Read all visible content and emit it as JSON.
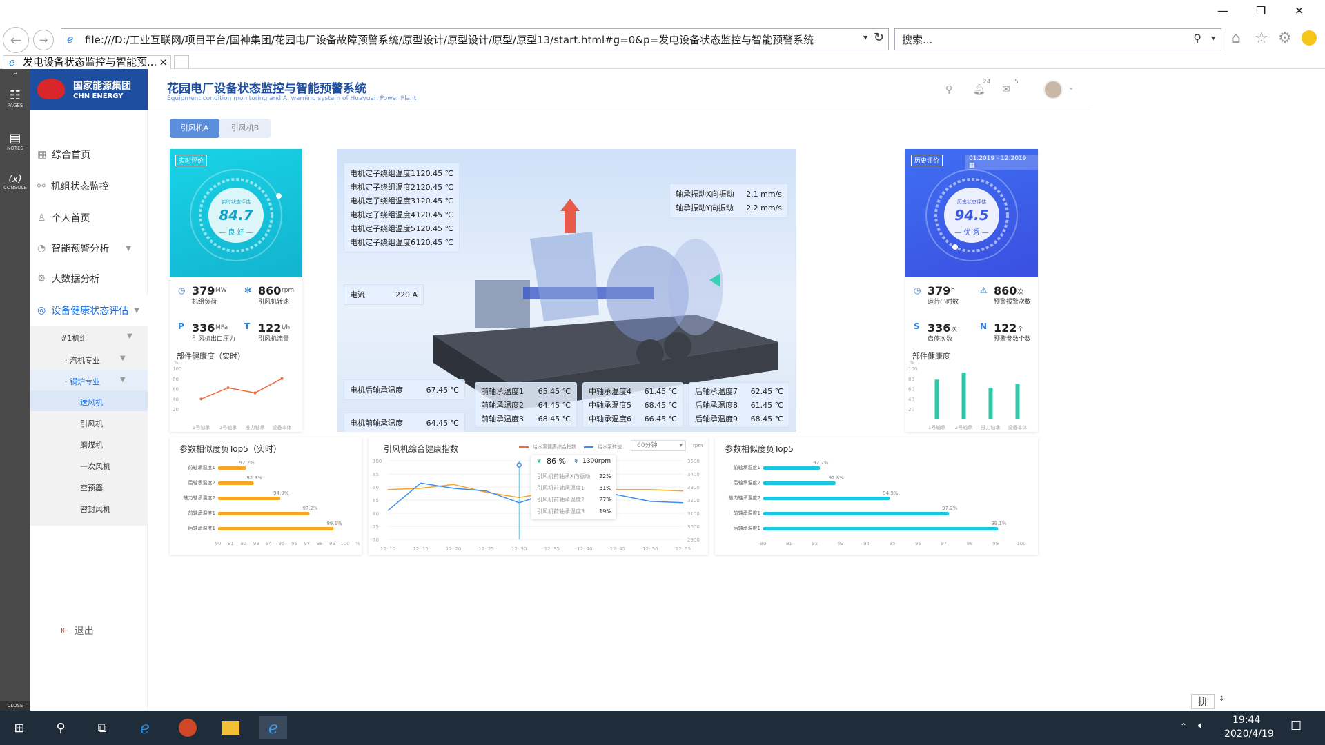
{
  "browser": {
    "address": "file:///D:/工业互联网/项目平台/国神集团/花园电厂设备故障预警系统/原型设计/原型设计/原型/原型13/start.html#g=0&p=发电设备状态监控与智能预警系统",
    "search_placeholder": "搜索...",
    "tab_title": "发电设备状态监控与智能预...",
    "tab_close": "×"
  },
  "axure": {
    "pages": "PAGES",
    "notes": "NOTES",
    "console": "CONSOLE",
    "console_symbol": "(x)",
    "close": "CLOSE"
  },
  "logo": {
    "cn": "国家能源集团",
    "en": "CHN ENERGY"
  },
  "header": {
    "title": "花园电厂设备状态监控与智能预警系统",
    "subtitle": "Equipment condition monitoring and AI warning system of Huayuan Power Plant",
    "bell_count": "24",
    "mail_count": "5"
  },
  "sidebar": {
    "items": [
      {
        "label": "综合首页"
      },
      {
        "label": "机组状态监控"
      },
      {
        "label": "个人首页"
      },
      {
        "label": "智能预警分析"
      },
      {
        "label": "大数据分析"
      },
      {
        "label": "设备健康状态评估"
      }
    ],
    "unit": "#1机组",
    "steam": "· 汽机专业",
    "boiler": "· 锅炉专业",
    "subs": [
      "送风机",
      "引风机",
      "磨煤机",
      "一次风机",
      "空预器",
      "密封风机"
    ],
    "logout": "退出"
  },
  "tabs": [
    "引风机A",
    "引风机B"
  ],
  "realtime": {
    "badge": "实时评价",
    "gauge_label": "实时状态评估",
    "score": "84.7",
    "grade": "— 良 好 —",
    "metrics": [
      {
        "value": "379",
        "unit": "MW",
        "label": "机组负荷"
      },
      {
        "value": "860",
        "unit": "rpm",
        "label": "引风机转速"
      },
      {
        "value": "336",
        "unit": "MPa",
        "label": "引风机出口压力"
      },
      {
        "value": "122",
        "unit": "t/h",
        "label": "引风机流量"
      }
    ],
    "health_title": "部件健康度（实时）",
    "health_ticks": [
      "100",
      "80",
      "60",
      "40",
      "20"
    ],
    "health_cats": [
      "1号轴承",
      "2号轴承",
      "推力轴承",
      "设备本体"
    ]
  },
  "history": {
    "badge": "历史评价",
    "date_range": "01.2019 - 12.2019",
    "gauge_label": "历史状态评估",
    "score": "94.5",
    "grade": "— 优 秀 —",
    "metrics": [
      {
        "value": "379",
        "unit": "h",
        "label": "运行小时数"
      },
      {
        "value": "860",
        "unit": "次",
        "label": "预警报警次数"
      },
      {
        "value": "336",
        "unit": "次",
        "label": "启停次数"
      },
      {
        "value": "122",
        "unit": "个",
        "label": "预警参数个数"
      }
    ],
    "health_title": "部件健康度",
    "health_ticks": [
      "100",
      "80",
      "60",
      "40",
      "20"
    ],
    "health_cats": [
      "1号轴承",
      "2号轴承",
      "推力轴承",
      "设备本体"
    ]
  },
  "readings": {
    "stator": [
      {
        "label": "电机定子绕组温度1",
        "value": "120.45 ℃"
      },
      {
        "label": "电机定子绕组温度2",
        "value": "120.45 ℃"
      },
      {
        "label": "电机定子绕组温度3",
        "value": "120.45 ℃"
      },
      {
        "label": "电机定子绕组温度4",
        "value": "120.45 ℃"
      },
      {
        "label": "电机定子绕组温度5",
        "value": "120.45 ℃"
      },
      {
        "label": "电机定子绕组温度6",
        "value": "120.45 ℃"
      }
    ],
    "current": {
      "label": "电流",
      "value": "220 A"
    },
    "vibration": [
      {
        "label": "轴承振动X向振动",
        "value": "2.1 mm/s"
      },
      {
        "label": "轴承振动Y向振动",
        "value": "2.2 mm/s"
      }
    ],
    "motor_rear": {
      "label": "电机后轴承温度",
      "value": "67.45 ℃"
    },
    "motor_front": {
      "label": "电机前轴承温度",
      "value": "64.45 ℃"
    },
    "front_bearing": [
      {
        "label": "前轴承温度1",
        "value": "65.45 ℃"
      },
      {
        "label": "前轴承温度2",
        "value": "64.45 ℃"
      },
      {
        "label": "前轴承温度3",
        "value": "68.45 ℃"
      }
    ],
    "mid_bearing": [
      {
        "label": "中轴承温度4",
        "value": "61.45 ℃"
      },
      {
        "label": "中轴承温度5",
        "value": "68.45 ℃"
      },
      {
        "label": "中轴承温度6",
        "value": "66.45 ℃"
      }
    ],
    "rear_bearing": [
      {
        "label": "后轴承温度7",
        "value": "62.45 ℃"
      },
      {
        "label": "后轴承温度8",
        "value": "61.45 ℃"
      },
      {
        "label": "后轴承温度9",
        "value": "68.45 ℃"
      }
    ]
  },
  "bottom": {
    "top5_rt_title": "参数相似度负Top5（实时）",
    "top5_title": "参数相似度负Top5",
    "health_title": "引风机综合健康指数",
    "legend1": "给水泵健康综合指数",
    "legend2": "给水泵转速",
    "interval": "60分钟",
    "unit_right": "rpm",
    "tooltip": {
      "pct": "86 %",
      "rpm": "1300rpm",
      "rows": [
        {
          "label": "引风机前轴承X向振动",
          "value": "22%"
        },
        {
          "label": "引风机前轴承温度1",
          "value": "31%"
        },
        {
          "label": "引风机前轴承温度2",
          "value": "27%"
        },
        {
          "label": "引风机前轴承温度3",
          "value": "19%"
        }
      ]
    }
  },
  "system": {
    "time": "19:44",
    "date": "2020/4/19",
    "ime": "拼"
  },
  "colors": {
    "brand": "#1e4ea0",
    "cyan": "#1ac7e0",
    "blue": "#3d5ef0",
    "orange": "#f5a623",
    "red": "#f06a3a"
  },
  "chart_data": [
    {
      "type": "line",
      "title": "部件健康度（实时）",
      "categories": [
        "1号轴承",
        "2号轴承",
        "推力轴承",
        "设备本体"
      ],
      "values": [
        40,
        62,
        52,
        80
      ],
      "ylim": [
        0,
        100
      ]
    },
    {
      "type": "bar",
      "title": "部件健康度",
      "categories": [
        "1号轴承",
        "2号轴承",
        "推力轴承",
        "设备本体"
      ],
      "values": [
        78,
        92,
        62,
        70
      ],
      "ylim": [
        0,
        100
      ]
    },
    {
      "type": "bar",
      "title": "参数相似度负Top5（实时）",
      "orientation": "horizontal",
      "categories": [
        "前轴承温度1",
        "后轴承温度2",
        "推力轴承温度2",
        "前轴承温度1",
        "后轴承温度1"
      ],
      "values": [
        92.2,
        92.8,
        94.9,
        97.2,
        99.1
      ],
      "labels": [
        "92.2%",
        "92.8%",
        "94.9%",
        "97.2%",
        "99.1%"
      ],
      "xticks": [
        "90",
        "91",
        "92",
        "93",
        "94",
        "95",
        "96",
        "97",
        "98",
        "99",
        "100",
        "%"
      ],
      "xlim": [
        90,
        100
      ]
    },
    {
      "type": "line",
      "title": "引风机综合健康指数",
      "x": [
        "12: 10",
        "12: 15",
        "12: 20",
        "12: 25",
        "12: 30",
        "12: 35",
        "12: 40",
        "12: 45",
        "12: 50",
        "12: 55"
      ],
      "yticks_left": [
        "100",
        "95",
        "90",
        "85",
        "80",
        "75",
        "70"
      ],
      "yticks_right": [
        "3500",
        "3400",
        "3300",
        "3200",
        "3100",
        "3000",
        "2900"
      ],
      "series": [
        {
          "name": "给水泵健康综合指数",
          "values": [
            89,
            89.5,
            91,
            88,
            86,
            88,
            88,
            89,
            89,
            88.5
          ]
        },
        {
          "name": "给水泵转速",
          "values": [
            3120,
            3330,
            3290,
            3270,
            3180,
            3260,
            3280,
            3240,
            3190,
            3180
          ]
        }
      ],
      "ylim_left": [
        70,
        100
      ],
      "ylim_right": [
        2900,
        3500
      ]
    },
    {
      "type": "bar",
      "title": "参数相似度负Top5",
      "orientation": "horizontal",
      "categories": [
        "前轴承温度1",
        "后轴承温度2",
        "推力轴承温度2",
        "前轴承温度1",
        "后轴承温度1"
      ],
      "values": [
        92.2,
        92.8,
        94.9,
        97.2,
        99.1
      ],
      "labels": [
        "92.2%",
        "92.8%",
        "94.9%",
        "97.2%",
        "99.1%"
      ],
      "xticks": [
        "90",
        "91",
        "92",
        "93",
        "94",
        "95",
        "96",
        "97",
        "98",
        "99",
        "100",
        "%"
      ],
      "xlim": [
        90,
        100
      ]
    }
  ]
}
